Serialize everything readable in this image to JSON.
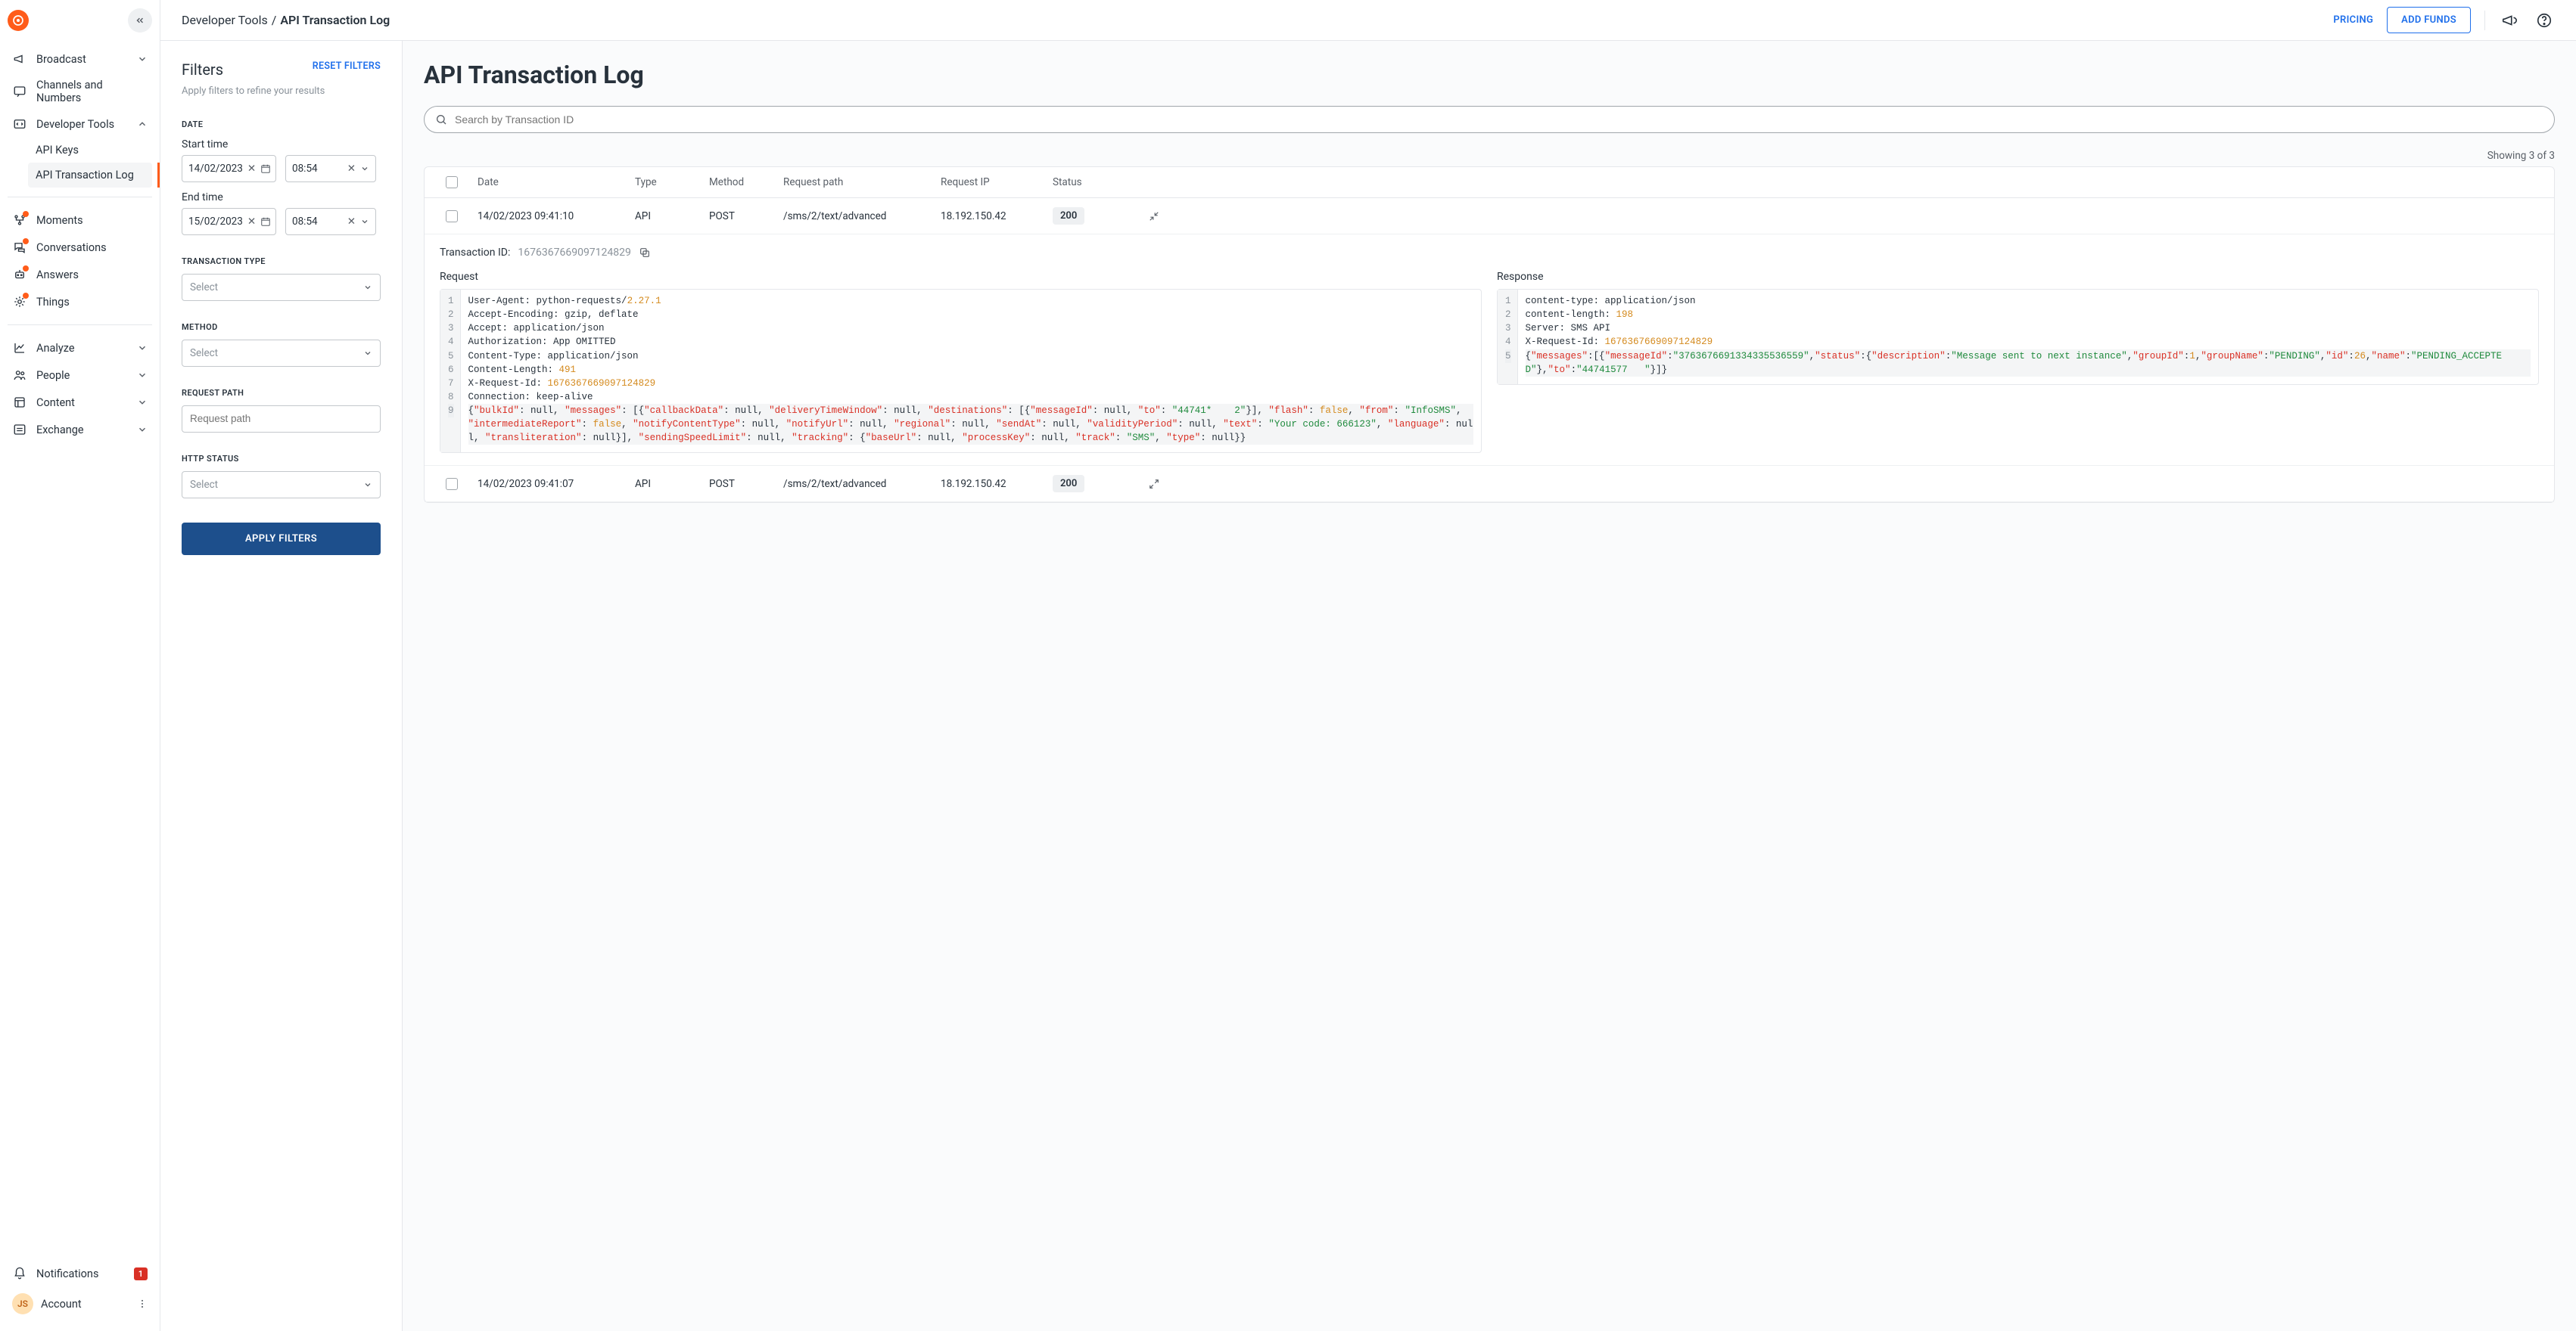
{
  "brand": {
    "accent": "#ff5c1a",
    "primary_action": "#1d4f8c",
    "link": "#1f6feb"
  },
  "topbar": {
    "breadcrumb_parent": "Developer Tools",
    "breadcrumb_current": "API Transaction Log",
    "pricing_label": "PRICING",
    "add_funds_label": "ADD FUNDS"
  },
  "sidebar": {
    "items": [
      {
        "label": "Broadcast",
        "icon": "megaphone-icon",
        "expandable": true
      },
      {
        "label": "Channels and Numbers",
        "icon": "chat-icon"
      },
      {
        "label": "Developer Tools",
        "icon": "code-icon",
        "expandable": true,
        "expanded": true,
        "children": [
          {
            "label": "API Keys"
          },
          {
            "label": "API Transaction Log",
            "active": true
          }
        ]
      },
      {
        "label": "Moments",
        "icon": "flow-icon",
        "dot": true
      },
      {
        "label": "Conversations",
        "icon": "conversations-icon",
        "dot": true
      },
      {
        "label": "Answers",
        "icon": "bot-icon",
        "dot": true
      },
      {
        "label": "Things",
        "icon": "things-icon",
        "dot": true
      },
      {
        "label": "Analyze",
        "icon": "chart-icon",
        "expandable": true
      },
      {
        "label": "People",
        "icon": "people-icon",
        "expandable": true
      },
      {
        "label": "Content",
        "icon": "content-icon",
        "expandable": true
      },
      {
        "label": "Exchange",
        "icon": "exchange-icon",
        "expandable": true
      }
    ],
    "notifications_label": "Notifications",
    "notifications_count": "1",
    "account_label": "Account",
    "account_initials": "JS"
  },
  "filters": {
    "title": "Filters",
    "reset_label": "RESET FILTERS",
    "subtitle": "Apply filters to refine your results",
    "date_label": "DATE",
    "start_label": "Start time",
    "start_date": "14/02/2023",
    "start_time": "08:54",
    "end_label": "End time",
    "end_date": "15/02/2023",
    "end_time": "08:54",
    "txtype_label": "TRANSACTION TYPE",
    "method_label": "METHOD",
    "reqpath_label": "REQUEST PATH",
    "reqpath_placeholder": "Request path",
    "http_label": "HTTP STATUS",
    "select_placeholder": "Select",
    "apply_label": "APPLY FILTERS"
  },
  "results": {
    "page_title": "API Transaction Log",
    "search_placeholder": "Search by Transaction ID",
    "showing": "Showing 3 of 3",
    "columns": [
      "Date",
      "Type",
      "Method",
      "Request path",
      "Request IP",
      "Status"
    ],
    "rows": [
      {
        "date": "14/02/2023 09:41:10",
        "type": "API",
        "method": "POST",
        "path": "/sms/2/text/advanced",
        "ip": "18.192.150.42",
        "status": "200",
        "expanded": true
      },
      {
        "date": "14/02/2023 09:41:07",
        "type": "API",
        "method": "POST",
        "path": "/sms/2/text/advanced",
        "ip": "18.192.150.42",
        "status": "200",
        "expanded": false
      }
    ],
    "detail": {
      "txid_label": "Transaction ID:",
      "txid": "1676367669097124829",
      "request_label": "Request",
      "response_label": "Response",
      "request_lines_count": 9,
      "request_html": "User-Agent: python-requests/<span class='tok-n'>2.27.1</span>\nAccept-Encoding: gzip, deflate\nAccept: application/json\nAuthorization: App OMITTED\nContent-Type: application/json\nContent-Length: <span class='tok-n'>491</span>\nX-Request-Id: <span class='tok-n'>1676367669097124829</span>\nConnection: keep-alive\n<span class='hl'>{<span class='tok-k'>\"bulkId\"</span>: null, <span class='tok-k'>\"messages\"</span>: [{<span class='tok-k'>\"callbackData\"</span>: null, <span class='tok-k'>\"deliveryTimeWindow\"</span>: null, <span class='tok-k'>\"destinations\"</span>: [{<span class='tok-k'>\"messageId\"</span>: null, <span class='tok-k'>\"to\"</span>: <span class='tok-s'>\"44741*    2\"</span>}], <span class='tok-k'>\"flash\"</span>: <span class='tok-b'>false</span>, <span class='tok-k'>\"from\"</span>: <span class='tok-s'>\"InfoSMS\"</span>, <span class='tok-k'>\"intermediateReport\"</span>: <span class='tok-b'>false</span>, <span class='tok-k'>\"notifyContentType\"</span>: null, <span class='tok-k'>\"notifyUrl\"</span>: null, <span class='tok-k'>\"regional\"</span>: null, <span class='tok-k'>\"sendAt\"</span>: null, <span class='tok-k'>\"validityPeriod\"</span>: null, <span class='tok-k'>\"text\"</span>: <span class='tok-s'>\"Your code: 666123\"</span>, <span class='tok-k'>\"language\"</span>: null, <span class='tok-k'>\"transliteration\"</span>: null}], <span class='tok-k'>\"sendingSpeedLimit\"</span>: null, <span class='tok-k'>\"tracking\"</span>: {<span class='tok-k'>\"baseUrl\"</span>: null, <span class='tok-k'>\"processKey\"</span>: null, <span class='tok-k'>\"track\"</span>: <span class='tok-s'>\"SMS\"</span>, <span class='tok-k'>\"type\"</span>: null}}</span>",
      "response_lines_count": 5,
      "response_html": "content-type: application/json\ncontent-length: <span class='tok-n'>198</span>\nServer: SMS API\nX-Request-Id: <span class='tok-n'>1676367669097124829</span>\n<span class='hl'>{<span class='tok-k'>\"messages\"</span>:[{<span class='tok-k'>\"messageId\"</span>:<span class='tok-s'>\"3763676691334335536559\"</span>,<span class='tok-k'>\"status\"</span>:{<span class='tok-k'>\"description\"</span>:<span class='tok-s'>\"Message sent to next instance\"</span>,<span class='tok-k'>\"groupId\"</span>:<span class='tok-n'>1</span>,<span class='tok-k'>\"groupName\"</span>:<span class='tok-s'>\"PENDING\"</span>,<span class='tok-k'>\"id\"</span>:<span class='tok-n'>26</span>,<span class='tok-k'>\"name\"</span>:<span class='tok-s'>\"PENDING_ACCEPTED\"</span>},<span class='tok-k'>\"to\"</span>:<span class='tok-s'>\"44741577   \"</span>}]}</span>"
    }
  }
}
